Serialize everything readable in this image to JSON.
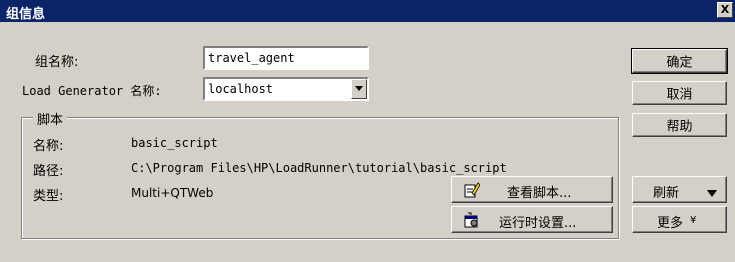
{
  "window": {
    "title": "组信息",
    "close_glyph": "X"
  },
  "form": {
    "group_name_label": "组名称:",
    "group_name_value": "travel_agent",
    "load_generator_label": "Load Generator 名称:",
    "load_generator_value": "localhost"
  },
  "script_group": {
    "legend": "脚本",
    "name_label": "名称:",
    "name_value": "basic_script",
    "path_label": "路径:",
    "path_value": "C:\\Program Files\\HP\\LoadRunner\\tutorial\\basic_script",
    "type_label": "类型:",
    "type_value": "Multi+QTWeb",
    "view_script_button": "查看脚本...",
    "runtime_settings_button": "运行时设置..."
  },
  "buttons": {
    "ok": "确定",
    "cancel": "取消",
    "help": "帮助",
    "refresh": "刷新",
    "more": "更多",
    "more_glyph": "¥"
  },
  "icons": {
    "view_script": "edit-document-icon",
    "runtime_settings": "runtime-settings-icon",
    "refresh_dropdown": "triangle-down-icon"
  }
}
